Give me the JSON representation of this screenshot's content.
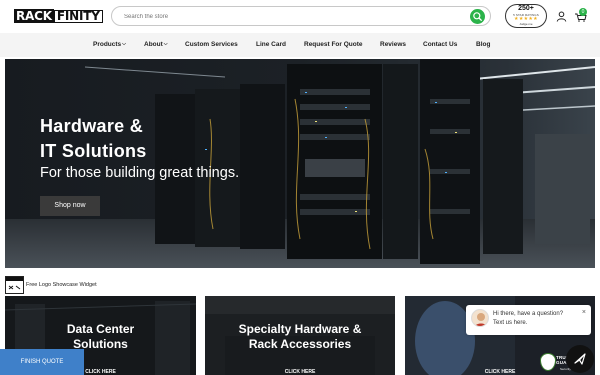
{
  "header": {
    "logo_left": "RACK",
    "logo_right": "FINITY",
    "search_placeholder": "Search the store",
    "icons": {
      "search": "search-icon",
      "account": "user-icon",
      "cart": "cart-icon"
    },
    "cart_count": "0",
    "badge": {
      "count": "250+",
      "subtitle": "5 STAR RATINGS",
      "stars": "★★★★★",
      "brand": "Judge.me"
    }
  },
  "nav": {
    "items": [
      {
        "label": "Products",
        "dropdown": true
      },
      {
        "label": "About",
        "dropdown": true
      },
      {
        "label": "Custom Services",
        "dropdown": false
      },
      {
        "label": "Line Card",
        "dropdown": false
      },
      {
        "label": "Request For Quote",
        "dropdown": false
      },
      {
        "label": "Reviews",
        "dropdown": false
      },
      {
        "label": "Contact Us",
        "dropdown": false
      },
      {
        "label": "Blog",
        "dropdown": false
      }
    ]
  },
  "hero": {
    "title_line1": "Hardware &",
    "title_line2": "IT Solutions",
    "subtitle": "For those building great things.",
    "button": "Shop now"
  },
  "showcase": {
    "label": "Free Logo Showcase Widget"
  },
  "cards": [
    {
      "title_line1": "Data Center",
      "title_line2": "Solutions",
      "cta": "CLICK HERE"
    },
    {
      "title_line1": "Specialty Hardware &",
      "title_line2": "Rack Accessories",
      "cta": "CLICK HERE"
    },
    {
      "title_line1": "",
      "title_line2": "",
      "cta": "CLICK HERE"
    }
  ],
  "finish_quote": "FINISH QUOTE",
  "chat": {
    "line1": "Hi there, have a question?",
    "line2": "Text us here.",
    "close": "×"
  },
  "trust_guard": {
    "line1": "TRUST",
    "line2": "GUARD",
    "sub": "Security Scanned"
  },
  "colors": {
    "accent_green": "#2bb34a",
    "finish_blue": "#3f80c9",
    "nav_bg": "#f4f4f4"
  }
}
